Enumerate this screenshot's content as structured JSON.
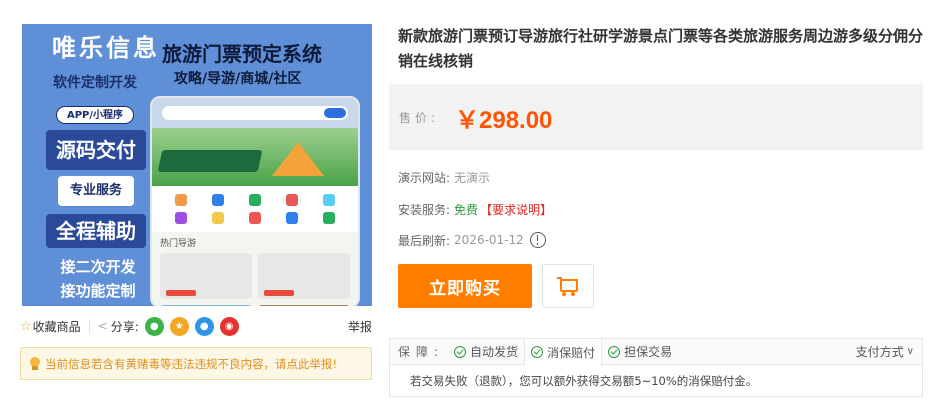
{
  "product_image": {
    "brand": "唯乐信息",
    "headline": "旅游门票预定系统",
    "subline": "攻略/导游/商城/社区",
    "tag_custom": "软件定制开发",
    "tag_app": "APP/小程序",
    "tag_source": "源码交付",
    "tag_pro": "专业服务",
    "tag_full": "全程辅助",
    "tag_secondary_1": "接二次开发",
    "tag_secondary_2": "接功能定制",
    "phone_section": "热门导游"
  },
  "actions": {
    "favorite": "收藏商品",
    "share_label": "分享:",
    "report": "举报"
  },
  "notice": "当前信息若含有黄赌毒等违法违规不良内容，请点此举报!",
  "product": {
    "title": "新款旅游门票预订导游旅行社研学游景点门票等各类旅游服务周边游多级分佣分销在线核销",
    "price_label": "售价:",
    "price": "￥298.00",
    "demo_label": "演示网站:",
    "demo_value": "无演示",
    "install_label": "安装服务:",
    "install_value": "免费",
    "install_link": "【要求说明】",
    "refresh_label": "最后刷新:",
    "refresh_value": "2026-01-12"
  },
  "buttons": {
    "buy": "立即购买"
  },
  "guarantee": {
    "label": "保障:",
    "tabs": [
      "自动发货",
      "消保赔付",
      "担保交易"
    ],
    "pay_method": "支付方式",
    "body": "若交易失败（退款），您可以额外获得交易额5~10%的消保赔付金。"
  },
  "colors": {
    "accent": "#ff7e00",
    "price": "#ff5500",
    "green": "#2b9a3c",
    "red": "#e2231a"
  }
}
